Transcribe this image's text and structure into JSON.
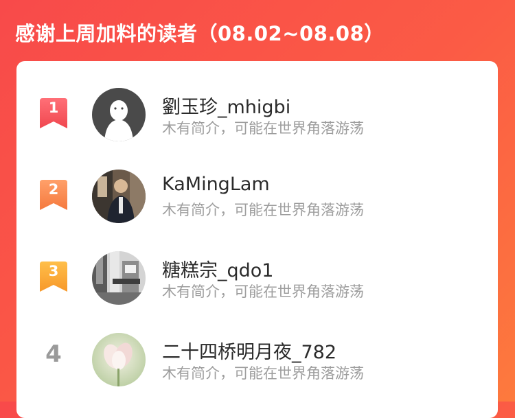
{
  "header": {
    "title": "感谢上周加料的读者（08.02~08.08）"
  },
  "colors": {
    "background_gradient": [
      "#f84a4a",
      "#fd7a3d"
    ],
    "rank1": "#f2575f",
    "rank2": "#f78a50",
    "rank3": "#f9a63a",
    "rank_plain": "#9a9a9a",
    "name": "#2b2b2b",
    "bio": "#9d9d9d"
  },
  "readers": [
    {
      "rank": "1",
      "name": "劉玉珍_mhigbi",
      "bio": "木有简介，可能在世界角落游荡",
      "avatar": "default-ghost-avatar"
    },
    {
      "rank": "2",
      "name": "KaMingLam",
      "bio": "木有简介，可能在世界角落游荡",
      "avatar": "photo-person-avatar"
    },
    {
      "rank": "3",
      "name": "糖糕宗_qdo1",
      "bio": "木有简介，可能在世界角落游荡",
      "avatar": "photo-bw-avatar"
    },
    {
      "rank": "4",
      "name": "二十四桥明月夜_782",
      "bio": "木有简介，可能在世界角落游荡",
      "avatar": "photo-flower-avatar"
    }
  ]
}
